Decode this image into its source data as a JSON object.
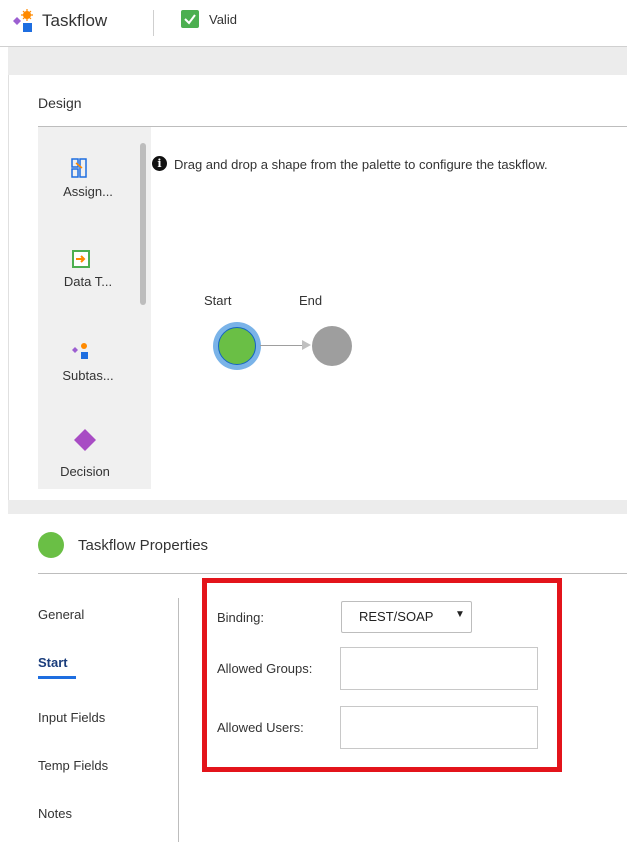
{
  "header": {
    "app_title": "Taskflow",
    "status_text": "Valid",
    "icon": "taskflow-icon"
  },
  "design": {
    "title": "Design",
    "palette": [
      {
        "label": "Assign...",
        "icon": "assignment-icon"
      },
      {
        "label": "Data T...",
        "icon": "data-task-icon"
      },
      {
        "label": "Subtas...",
        "icon": "subtaskflow-icon"
      },
      {
        "label": "Decision",
        "icon": "decision-icon"
      }
    ],
    "hint": "Drag and drop a shape from the palette to configure the taskflow.",
    "nodes": {
      "start": "Start",
      "end": "End"
    }
  },
  "properties": {
    "title": "Taskflow Properties",
    "nav": [
      "General",
      "Start",
      "Input Fields",
      "Temp Fields",
      "Notes"
    ],
    "active_nav": "Start",
    "fields": {
      "binding_label": "Binding:",
      "binding_value": "REST/SOAP",
      "groups_label": "Allowed Groups:",
      "groups_value": "",
      "users_label": "Allowed Users:",
      "users_value": ""
    }
  },
  "colors": {
    "accent": "#1e6ee0",
    "start_node": "#6abf45",
    "highlight": "#e3141b",
    "valid_check": "#4caf50"
  }
}
